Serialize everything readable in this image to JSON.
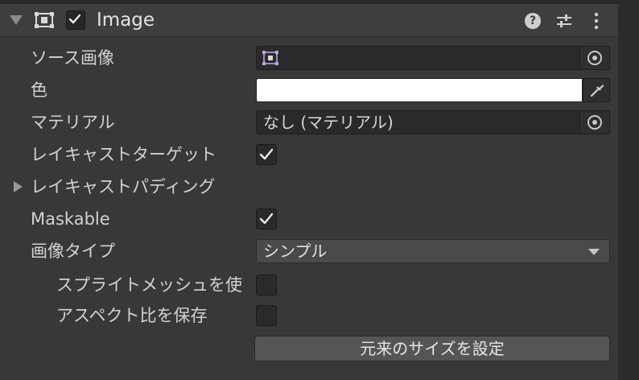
{
  "header": {
    "title": "Image",
    "enabled": true,
    "icons": [
      "image-component-icon",
      "help-icon",
      "preset-icon",
      "context-menu-icon"
    ]
  },
  "fields": {
    "source_image": {
      "label": "ソース画像",
      "value": ""
    },
    "color": {
      "label": "色",
      "value": "#ffffff"
    },
    "material": {
      "label": "マテリアル",
      "value": "なし (マテリアル)"
    },
    "raycast_target": {
      "label": "レイキャストターゲット",
      "checked": true
    },
    "raycast_padding": {
      "label": "レイキャストパディング",
      "expanded": false
    },
    "maskable": {
      "label": "Maskable",
      "checked": true
    },
    "image_type": {
      "label": "画像タイプ",
      "value": "シンプル"
    },
    "use_sprite_mesh": {
      "label": "スプライトメッシュを使",
      "checked": false
    },
    "preserve_aspect": {
      "label": "アスペクト比を保存",
      "checked": false
    }
  },
  "actions": {
    "set_native_size": "元来のサイズを設定"
  }
}
